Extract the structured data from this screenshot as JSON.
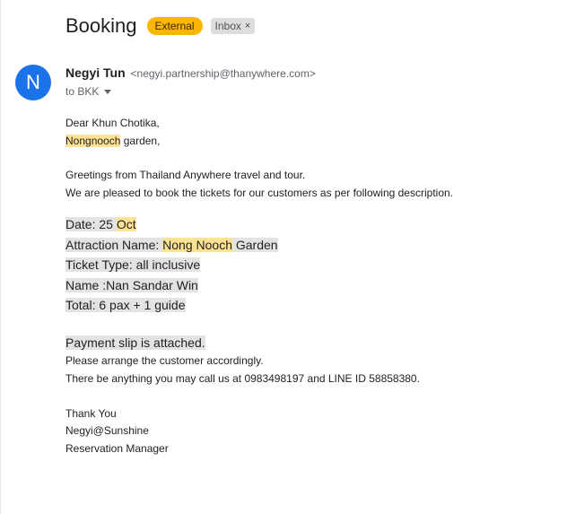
{
  "subject": "Booking",
  "labels": {
    "external": "External",
    "inbox": "Inbox",
    "inbox_remove": "×"
  },
  "sender": {
    "avatar_letter": "N",
    "avatar_color": "#1a73e8",
    "name": "Negyi Tun",
    "email": "<negyi.partnership@thanywhere.com>",
    "to": "to BKK"
  },
  "body": {
    "greeting": "Dear Khun Chotika,",
    "garden_name": "Nongnooch",
    "garden_rest": " garden,",
    "intro_1": "Greetings from Thailand Anywhere travel and tour.",
    "intro_2": "We are pleased to book the tickets for our customers as per following description.",
    "date_label": "Date: 25 ",
    "date_month": "Oct",
    "attraction_label": "Attraction Name: ",
    "attraction_name": "Nong Nooch",
    "attraction_rest": " Garden ",
    "ticket_type": "Ticket Type: all inclusive",
    "name_line": "Name :Nan Sandar Win",
    "total": "Total: 6 pax + 1 guide ",
    "payment": "Payment slip is attached.",
    "arrange": "Please arrange the customer accordingly.",
    "contact": "There be anything you may call us at 0983498197 and LINE ID 58858380.",
    "thanks": "Thank You",
    "signature": "Negyi@Sunshine",
    "role": "Reservation Manager"
  },
  "colors": {
    "external_badge": "#f9b604",
    "highlight_yellow": "#fde293",
    "highlight_grey": "#e3e3e3"
  }
}
